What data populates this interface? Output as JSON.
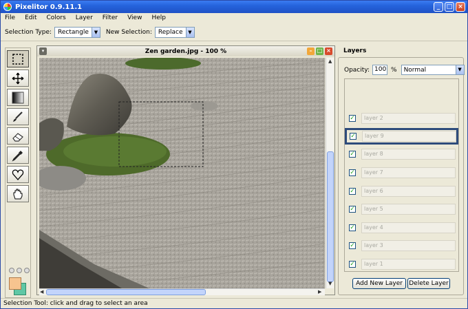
{
  "window": {
    "title": "Pixelitor 0.9.11.1"
  },
  "menu": [
    "File",
    "Edit",
    "Colors",
    "Layer",
    "Filter",
    "View",
    "Help"
  ],
  "options": {
    "selection_type_label": "Selection Type:",
    "selection_type_value": "Rectangle",
    "new_selection_label": "New Selection:",
    "new_selection_value": "Replace"
  },
  "tools": [
    "selection-tool",
    "move-tool",
    "gradient-tool",
    "brush-tool",
    "eraser-tool",
    "color-picker-tool",
    "shape-tool",
    "hand-tool"
  ],
  "colors": {
    "foreground": "#f7c48f",
    "background": "#5fc7a5"
  },
  "image_window": {
    "title": "Zen garden.jpg - 100 %"
  },
  "layers": {
    "title": "Layers",
    "opacity_label": "Opacity:",
    "opacity_value": "100",
    "percent": "%",
    "blend_mode": "Normal",
    "items": [
      {
        "name": "layer 2",
        "visible": true,
        "selected": false
      },
      {
        "name": "layer 9",
        "visible": true,
        "selected": true
      },
      {
        "name": "layer 8",
        "visible": true,
        "selected": false
      },
      {
        "name": "layer 7",
        "visible": true,
        "selected": false
      },
      {
        "name": "layer 6",
        "visible": true,
        "selected": false
      },
      {
        "name": "layer 5",
        "visible": true,
        "selected": false
      },
      {
        "name": "layer 4",
        "visible": true,
        "selected": false
      },
      {
        "name": "layer 3",
        "visible": true,
        "selected": false
      },
      {
        "name": "layer 1",
        "visible": true,
        "selected": false
      }
    ],
    "add_button": "Add New Layer",
    "delete_button": "Delete Layer"
  },
  "status": "Selection Tool: click and drag to select an area"
}
